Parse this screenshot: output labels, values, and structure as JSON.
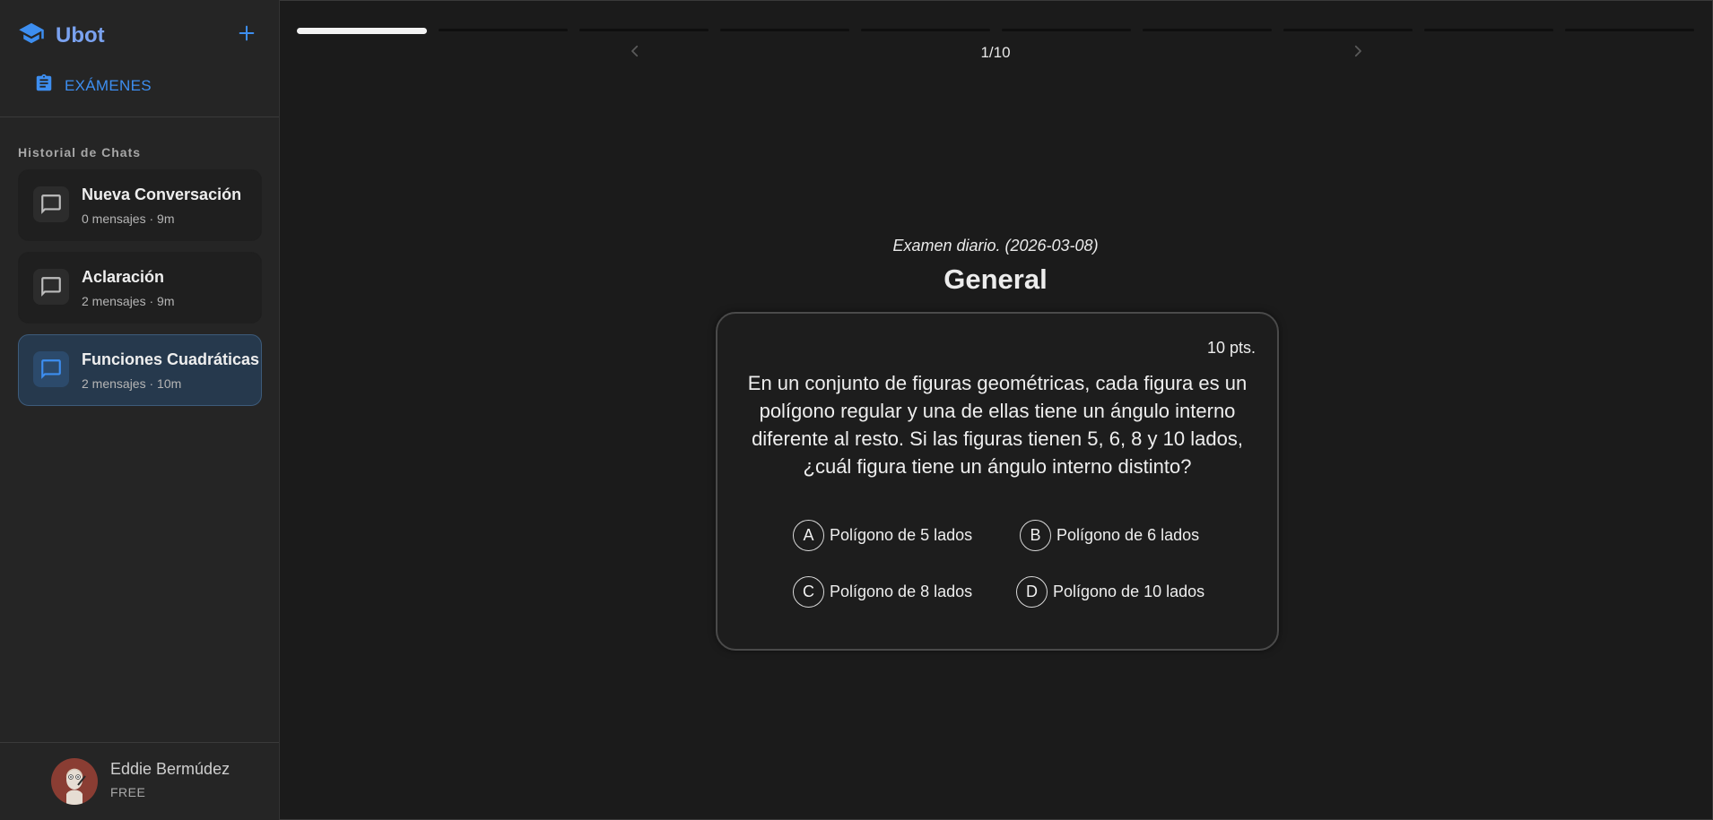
{
  "app": {
    "name": "Ubot"
  },
  "sidebar": {
    "exams_label": "EXÁMENES",
    "history_title": "Historial de Chats",
    "chats": [
      {
        "title": "Nueva Conversación",
        "meta": "0 mensajes · 9m",
        "active": false
      },
      {
        "title": "Aclaración",
        "meta": "2 mensajes · 9m",
        "active": false
      },
      {
        "title": "Funciones Cuadráticas",
        "meta": "2 mensajes · 10m",
        "active": true
      }
    ],
    "user": {
      "name": "Eddie Bermúdez",
      "plan": "FREE"
    }
  },
  "progress": {
    "current": 1,
    "total": 10,
    "counter_text": "1/10"
  },
  "exam": {
    "subtitle": "Examen diario. (2026-03-08)",
    "title": "General",
    "points": "10 pts.",
    "question": "En un conjunto de figuras geométricas, cada figura es un polígono regular y una de ellas tiene un ángulo interno diferente al resto. Si las figuras tienen 5, 6, 8 y 10 lados, ¿cuál figura tiene un ángulo interno distinto?",
    "options": [
      {
        "letter": "A",
        "text": "Polígono de 5 lados"
      },
      {
        "letter": "B",
        "text": "Polígono de 6 lados"
      },
      {
        "letter": "C",
        "text": "Polígono de 8 lados"
      },
      {
        "letter": "D",
        "text": "Polígono de 10 lados"
      }
    ]
  },
  "colors": {
    "accent": "#3d8ef0",
    "brand": "#7aa2f0",
    "background": "#1b1b1b",
    "sidebar": "#252525",
    "active_chat": "#26394d"
  },
  "icons": {
    "brand": "graduation-cap-icon",
    "new": "plus-icon",
    "exams": "clipboard-icon",
    "chat": "chat-bubble-icon",
    "prev": "chevron-left-icon",
    "next": "chevron-right-icon"
  }
}
